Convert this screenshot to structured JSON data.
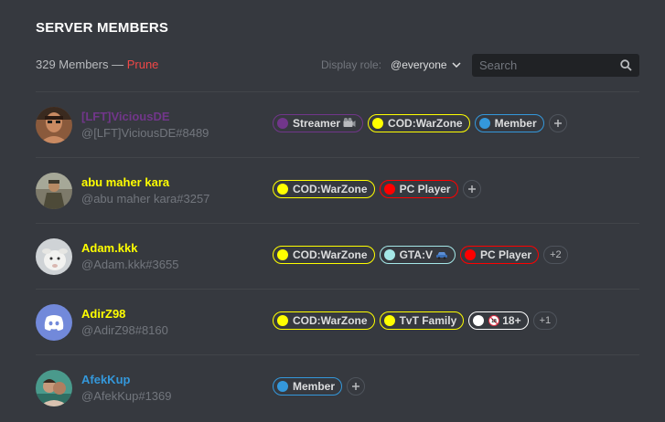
{
  "header": {
    "title": "SERVER MEMBERS",
    "count": "329 Members",
    "separator": " — ",
    "prune": "Prune",
    "display_role_label": "Display role:",
    "display_role_value": "@everyone",
    "search_placeholder": "Search"
  },
  "colors": {
    "background": "#36393f",
    "prune": "#f04747",
    "divider": "#42454a"
  },
  "members": [
    {
      "name": "[LFT]ViciousDE",
      "tag": "@[LFT]ViciousDE#8489",
      "name_color": "#71368a",
      "avatar": "photo",
      "roles": [
        {
          "label": "Streamer",
          "color": "#71368a",
          "emoji": "film-camera-icon"
        },
        {
          "label": "COD:WarZone",
          "color": "#ffff00"
        },
        {
          "label": "Member",
          "color": "#3498db"
        }
      ],
      "extra": "add"
    },
    {
      "name": "abu maher kara",
      "tag": "@abu maher kara#3257",
      "name_color": "#ffff00",
      "avatar": "photo",
      "roles": [
        {
          "label": "COD:WarZone",
          "color": "#ffff00"
        },
        {
          "label": "PC Player",
          "color": "#ff0000"
        }
      ],
      "extra": "add"
    },
    {
      "name": "Adam.kkk",
      "tag": "@Adam.kkk#3655",
      "name_color": "#ffff00",
      "avatar": "photo",
      "roles": [
        {
          "label": "COD:WarZone",
          "color": "#ffff00"
        },
        {
          "label": "GTA:V",
          "color": "#a5e8e8",
          "emoji": "car-icon"
        },
        {
          "label": "PC Player",
          "color": "#ff0000"
        }
      ],
      "extra": "+2"
    },
    {
      "name": "AdirZ98",
      "tag": "@AdirZ98#8160",
      "name_color": "#ffff00",
      "avatar": "discord-default-avatar",
      "roles": [
        {
          "label": "COD:WarZone",
          "color": "#ffff00"
        },
        {
          "label": "TvT Family",
          "color": "#ffff00"
        },
        {
          "label": "18+",
          "color": "#ffffff",
          "emoji": "no-under-18-icon"
        }
      ],
      "extra": "+1"
    },
    {
      "name": "AfekKup",
      "tag": "@AfekKup#1369",
      "name_color": "#3498db",
      "avatar": "photo",
      "roles": [
        {
          "label": "Member",
          "color": "#3498db"
        }
      ],
      "extra": "add"
    }
  ]
}
